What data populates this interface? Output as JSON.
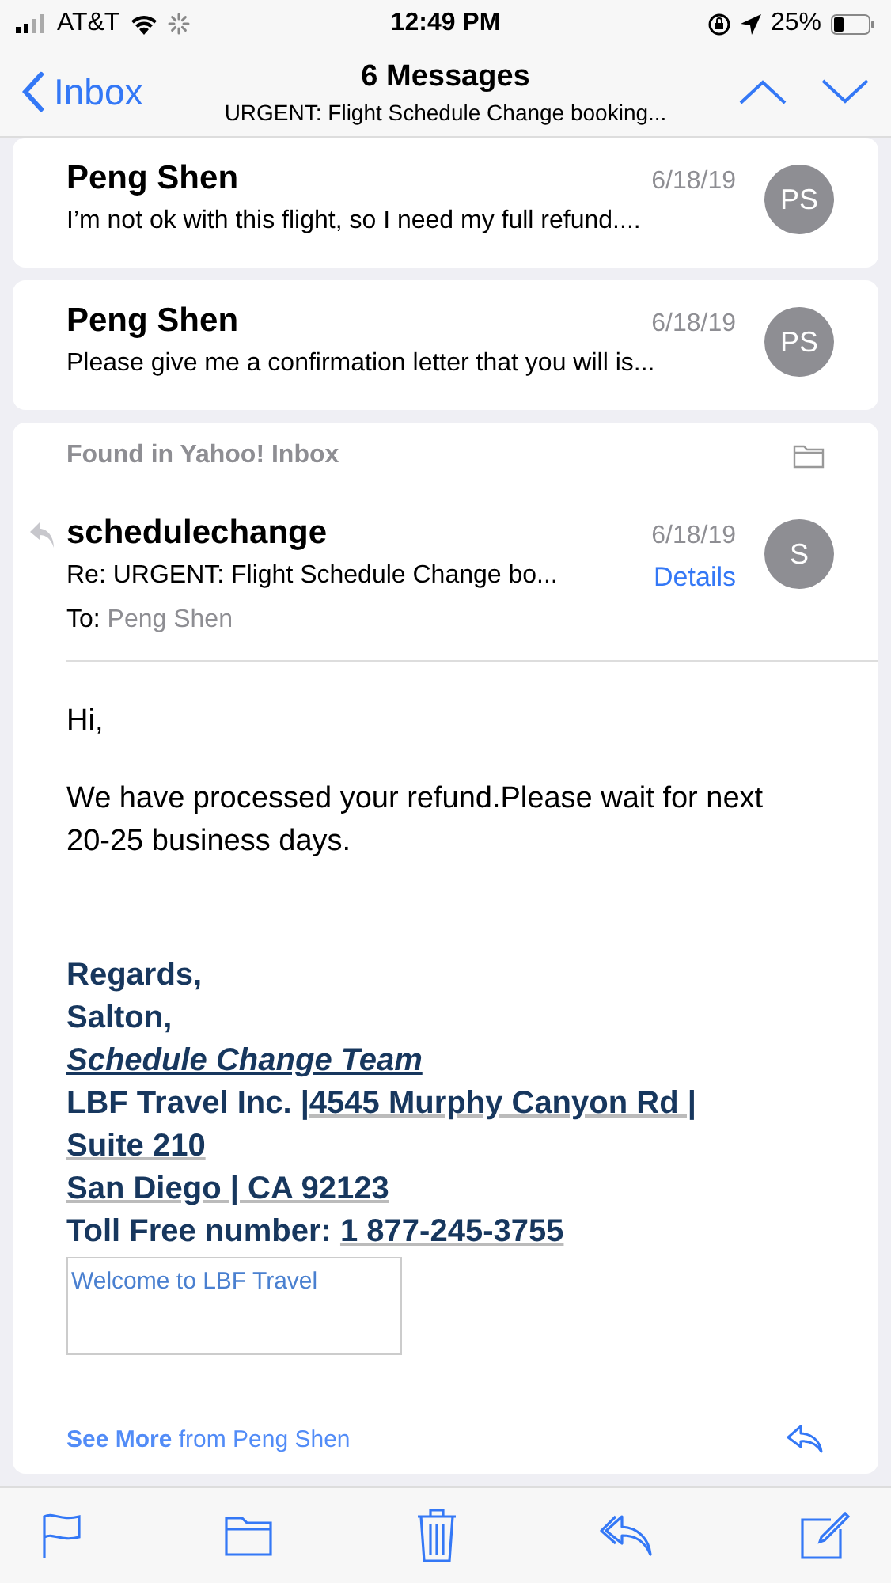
{
  "status_bar": {
    "carrier": "AT&T",
    "time": "12:49 PM",
    "battery": "25%"
  },
  "nav": {
    "back": "Inbox",
    "title": "6 Messages",
    "subtitle": "URGENT: Flight Schedule Change booking..."
  },
  "collapsed_messages": [
    {
      "sender": "Peng Shen",
      "date": "6/18/19",
      "snippet": "I’m not ok with this flight, so I need my full refund....",
      "initials": "PS"
    },
    {
      "sender": "Peng Shen",
      "date": "6/18/19",
      "snippet": "Please give me a confirmation letter that you will is...",
      "initials": "PS"
    }
  ],
  "open_message": {
    "found_in": "Found in Yahoo! Inbox",
    "replied": true,
    "sender": "schedulechange",
    "date": "6/18/19",
    "subject": "Re: URGENT: Flight Schedule Change bo...",
    "details": "Details",
    "initials": "S",
    "to_label": "To:",
    "to": "Peng Shen",
    "body": [
      "Hi,",
      "We have processed your refund.Please wait for next 20-25 business days."
    ],
    "signature": [
      [
        {
          "text": "Regards,",
          "kind": "plain"
        }
      ],
      [
        {
          "text": "Salton,",
          "kind": "plain"
        }
      ],
      [
        {
          "text": "Schedule Change Team",
          "kind": "italic-link"
        }
      ],
      [
        {
          "text": "LBF Travel Inc. |",
          "kind": "plain"
        },
        {
          "text": "4545 Murphy Canyon Rd |",
          "kind": "link"
        }
      ],
      [
        {
          "text": "Suite 210",
          "kind": "link"
        }
      ],
      [
        {
          "text": "San Diego | CA  92123",
          "kind": "link"
        }
      ],
      [
        {
          "text": "Toll Free number: ",
          "kind": "plain"
        },
        {
          "text": "1 877-245-3755",
          "kind": "link"
        }
      ]
    ],
    "image_alt": "Welcome to LBF Travel",
    "see_more_bold": "See More",
    "see_more_rest": " from Peng Shen"
  }
}
